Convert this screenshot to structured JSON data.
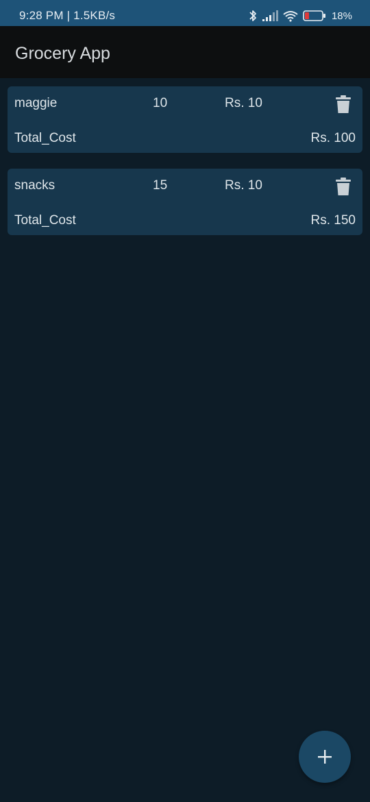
{
  "status_bar": {
    "time_net": "9:28 PM | 1.5KB/s",
    "battery": "18%"
  },
  "app_bar": {
    "title": "Grocery App"
  },
  "items": [
    {
      "name": "maggie",
      "quantity": "10",
      "price": "Rs. 10",
      "total_label": "Total_Cost",
      "total": "Rs. 100"
    },
    {
      "name": "snacks",
      "quantity": "15",
      "price": "Rs. 10",
      "total_label": "Total_Cost",
      "total": "Rs. 150"
    }
  ],
  "icons": {
    "delete": "trash-icon",
    "add": "plus-icon"
  },
  "colors": {
    "status_bar": "#1e5378",
    "app_bar": "#0d0f10",
    "background": "#0d1c27",
    "card": "#17374d",
    "fab": "#1b4865"
  }
}
